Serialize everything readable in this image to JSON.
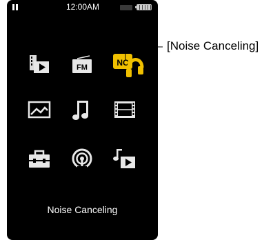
{
  "status_bar": {
    "clock": "12:00AM",
    "icons": [
      "pause-icon",
      "signal-icon",
      "battery-icon"
    ]
  },
  "menu": {
    "items": [
      {
        "name": "video-icon"
      },
      {
        "name": "fm-radio-icon",
        "label": "FM"
      },
      {
        "name": "noise-canceling-icon",
        "label": "NC",
        "selected": true
      },
      {
        "name": "photo-icon"
      },
      {
        "name": "music-icon"
      },
      {
        "name": "film-icon"
      },
      {
        "name": "settings-toolbox-icon"
      },
      {
        "name": "podcast-icon"
      },
      {
        "name": "music-video-icon"
      }
    ],
    "caption": "Noise Canceling"
  },
  "callout": {
    "label": "[Noise Canceling]"
  },
  "colors": {
    "background": "#000000",
    "icon": "#e8e8e8",
    "highlight": "#e6b800"
  }
}
